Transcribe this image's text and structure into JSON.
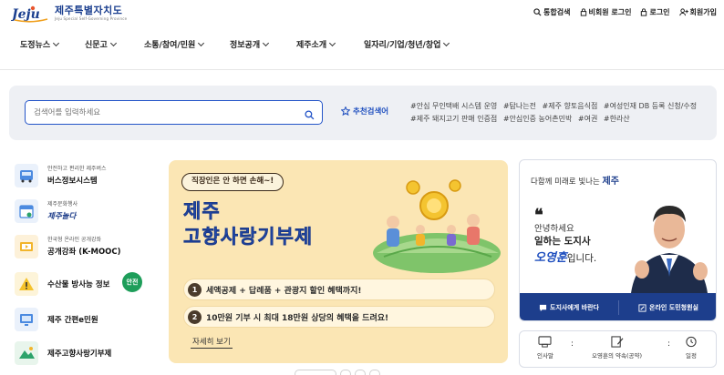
{
  "logo": {
    "title": "제주특별자치도",
    "mark": "Jeju",
    "subtitle": "Jeju Special Self-Governing Province"
  },
  "util": [
    {
      "icon": "search-icon",
      "label": "통합검색"
    },
    {
      "icon": "lock-icon",
      "label": "비회원 로그인"
    },
    {
      "icon": "lock-icon",
      "label": "로그인"
    },
    {
      "icon": "user-add-icon",
      "label": "회원가입"
    }
  ],
  "nav": [
    "도정뉴스",
    "신문고",
    "소통/참여/민원",
    "정보공개",
    "제주소개",
    "일자리/기업/청년/창업"
  ],
  "search": {
    "placeholder": "검색어를 입력하세요",
    "rec_label": "추천검색어"
  },
  "tags": [
    "#안심 무인택배 시스템 운영",
    "#탐나는전",
    "#제주 향토음식점",
    "#여성인재 DB 등록 신청/수정",
    "#제주 돼지고기 판매 인증점",
    "#안심인증 농어촌민박",
    "#여권",
    "#한라산"
  ],
  "quick": [
    {
      "small": "안전하고 편리한 제주버스",
      "big": "버스정보시스템"
    },
    {
      "small": "제주문화행사",
      "big": "제주놀다"
    },
    {
      "small": "한국형 온라인 공개강좌",
      "big": "공개강좌 (K-MOOC)"
    },
    {
      "small": "",
      "big": "수산물 방사능 정보",
      "badge": "안전"
    },
    {
      "small": "",
      "big": "제주 간편e민원"
    },
    {
      "small": "",
      "big": "제주고향사랑기부제"
    }
  ],
  "banner": {
    "pill": "직장인은 안 하면 손해~!",
    "title1": "제주",
    "title2": "고향사랑기부제",
    "rows": [
      {
        "num": "1",
        "text": "세액공제 + 답례품 + 관광지 할인 혜택까지!"
      },
      {
        "num": "2",
        "text": "10만원 기부 시 최대 18만원 상당의 혜택을 드려요!"
      }
    ],
    "more": "자세히 보기"
  },
  "governor": {
    "head_pre": "다함께 미래로 빛나는",
    "head_bold": "제주",
    "quote": "❝",
    "line1": "안녕하세요",
    "line2": "일하는 도지사",
    "sig": "오영훈",
    "line3_post": "입니다.",
    "btn1": "도지사에게 바란다",
    "btn2": "온라인 도민청원실"
  },
  "gov_links": [
    {
      "icon": "greeting-icon",
      "label": "인사말"
    },
    {
      "icon": "pledge-icon",
      "label": "오영훈의 약속(공약)"
    },
    {
      "icon": "schedule-icon",
      "label": "일정"
    }
  ],
  "colors": {
    "brand_blue": "#1d3e8c",
    "accent_blue": "#2455c8",
    "banner_bg": "#fbe6b4",
    "badge_green": "#1e9e5a"
  }
}
